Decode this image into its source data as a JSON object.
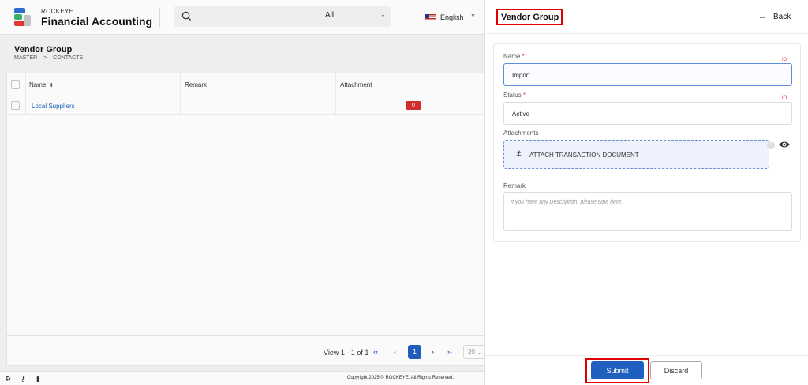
{
  "header": {
    "brand_top": "ROCKEYE",
    "brand_main": "Financial Accounting",
    "search_placeholder": "",
    "scope": "All",
    "language": "English"
  },
  "page": {
    "title": "Vendor Group",
    "breadcrumb": [
      "MASTER",
      ">",
      "CONTACTS"
    ]
  },
  "table": {
    "columns": [
      "Name",
      "Remark",
      "Attachment"
    ],
    "rows": [
      {
        "name": "Local Suppliers",
        "remark": "",
        "attachment": "0"
      }
    ],
    "view_count": "View 1 - 1 of 1",
    "current_page": "1",
    "page_size": "20"
  },
  "footer": {
    "copyright": "Copyright 2025 © ROCKEYE. All Rights Reserved."
  },
  "drawer": {
    "title": "Vendor Group",
    "back_label": "Back",
    "form": {
      "name_label": "Name",
      "name_value": "Import",
      "status_label": "Status",
      "status_value": "Active",
      "attachments_label": "Attachments",
      "attach_button": "ATTACH TRANSACTION DOCUMENT",
      "remark_label": "Remark",
      "remark_placeholder": "If you have any Description, please type here..",
      "required_mark": "*",
      "io_tag": "IO"
    },
    "submit_label": "Submit",
    "discard_label": "Discard"
  },
  "colors": {
    "primary": "#1f5fbf",
    "highlight": "#e00000",
    "badge": "#d32f2f"
  }
}
